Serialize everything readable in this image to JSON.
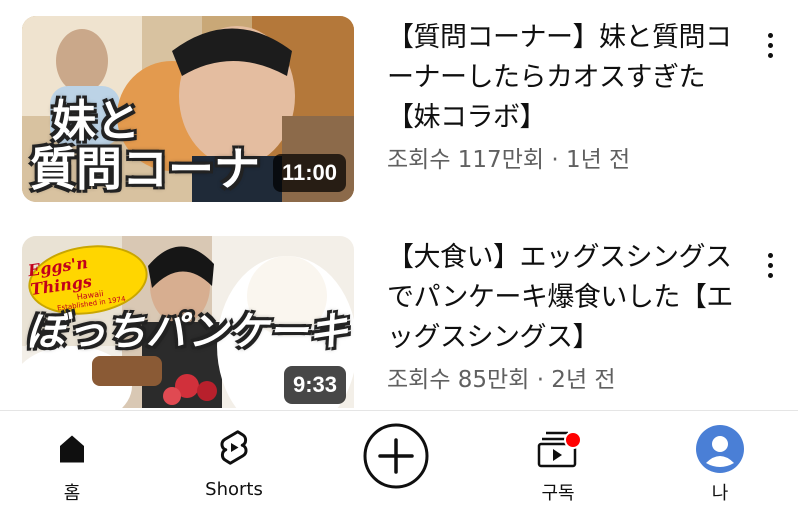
{
  "videos": [
    {
      "title": "【質問コーナー】妹と質問コーナーしたらカオスすぎた【妹コラボ】",
      "meta": "조회수 117만회 · 1년 전",
      "duration": "11:00",
      "thumb_text_line1": "妹と",
      "thumb_text_line2": "質問コーナ"
    },
    {
      "title": "【大食い】エッグスシングスでパンケーキ爆食いした【エッグスシングス】",
      "meta": "조회수 85만회 · 2년 전",
      "duration": "9:33",
      "thumb_text": "ぼっちパンケーキ",
      "logo_text": "Eggs'n Things",
      "logo_sub": "Hawaii",
      "logo_sub2": "Established in 1974"
    }
  ],
  "nav": {
    "home": "홈",
    "shorts": "Shorts",
    "subscriptions": "구독",
    "me": "나"
  },
  "colors": {
    "notification_dot": "#ff0000",
    "avatar": "#4a7fd6"
  },
  "icons": [
    "more-vert-icon",
    "home-icon",
    "shorts-icon",
    "create-plus-icon",
    "subscriptions-icon",
    "avatar-icon"
  ]
}
